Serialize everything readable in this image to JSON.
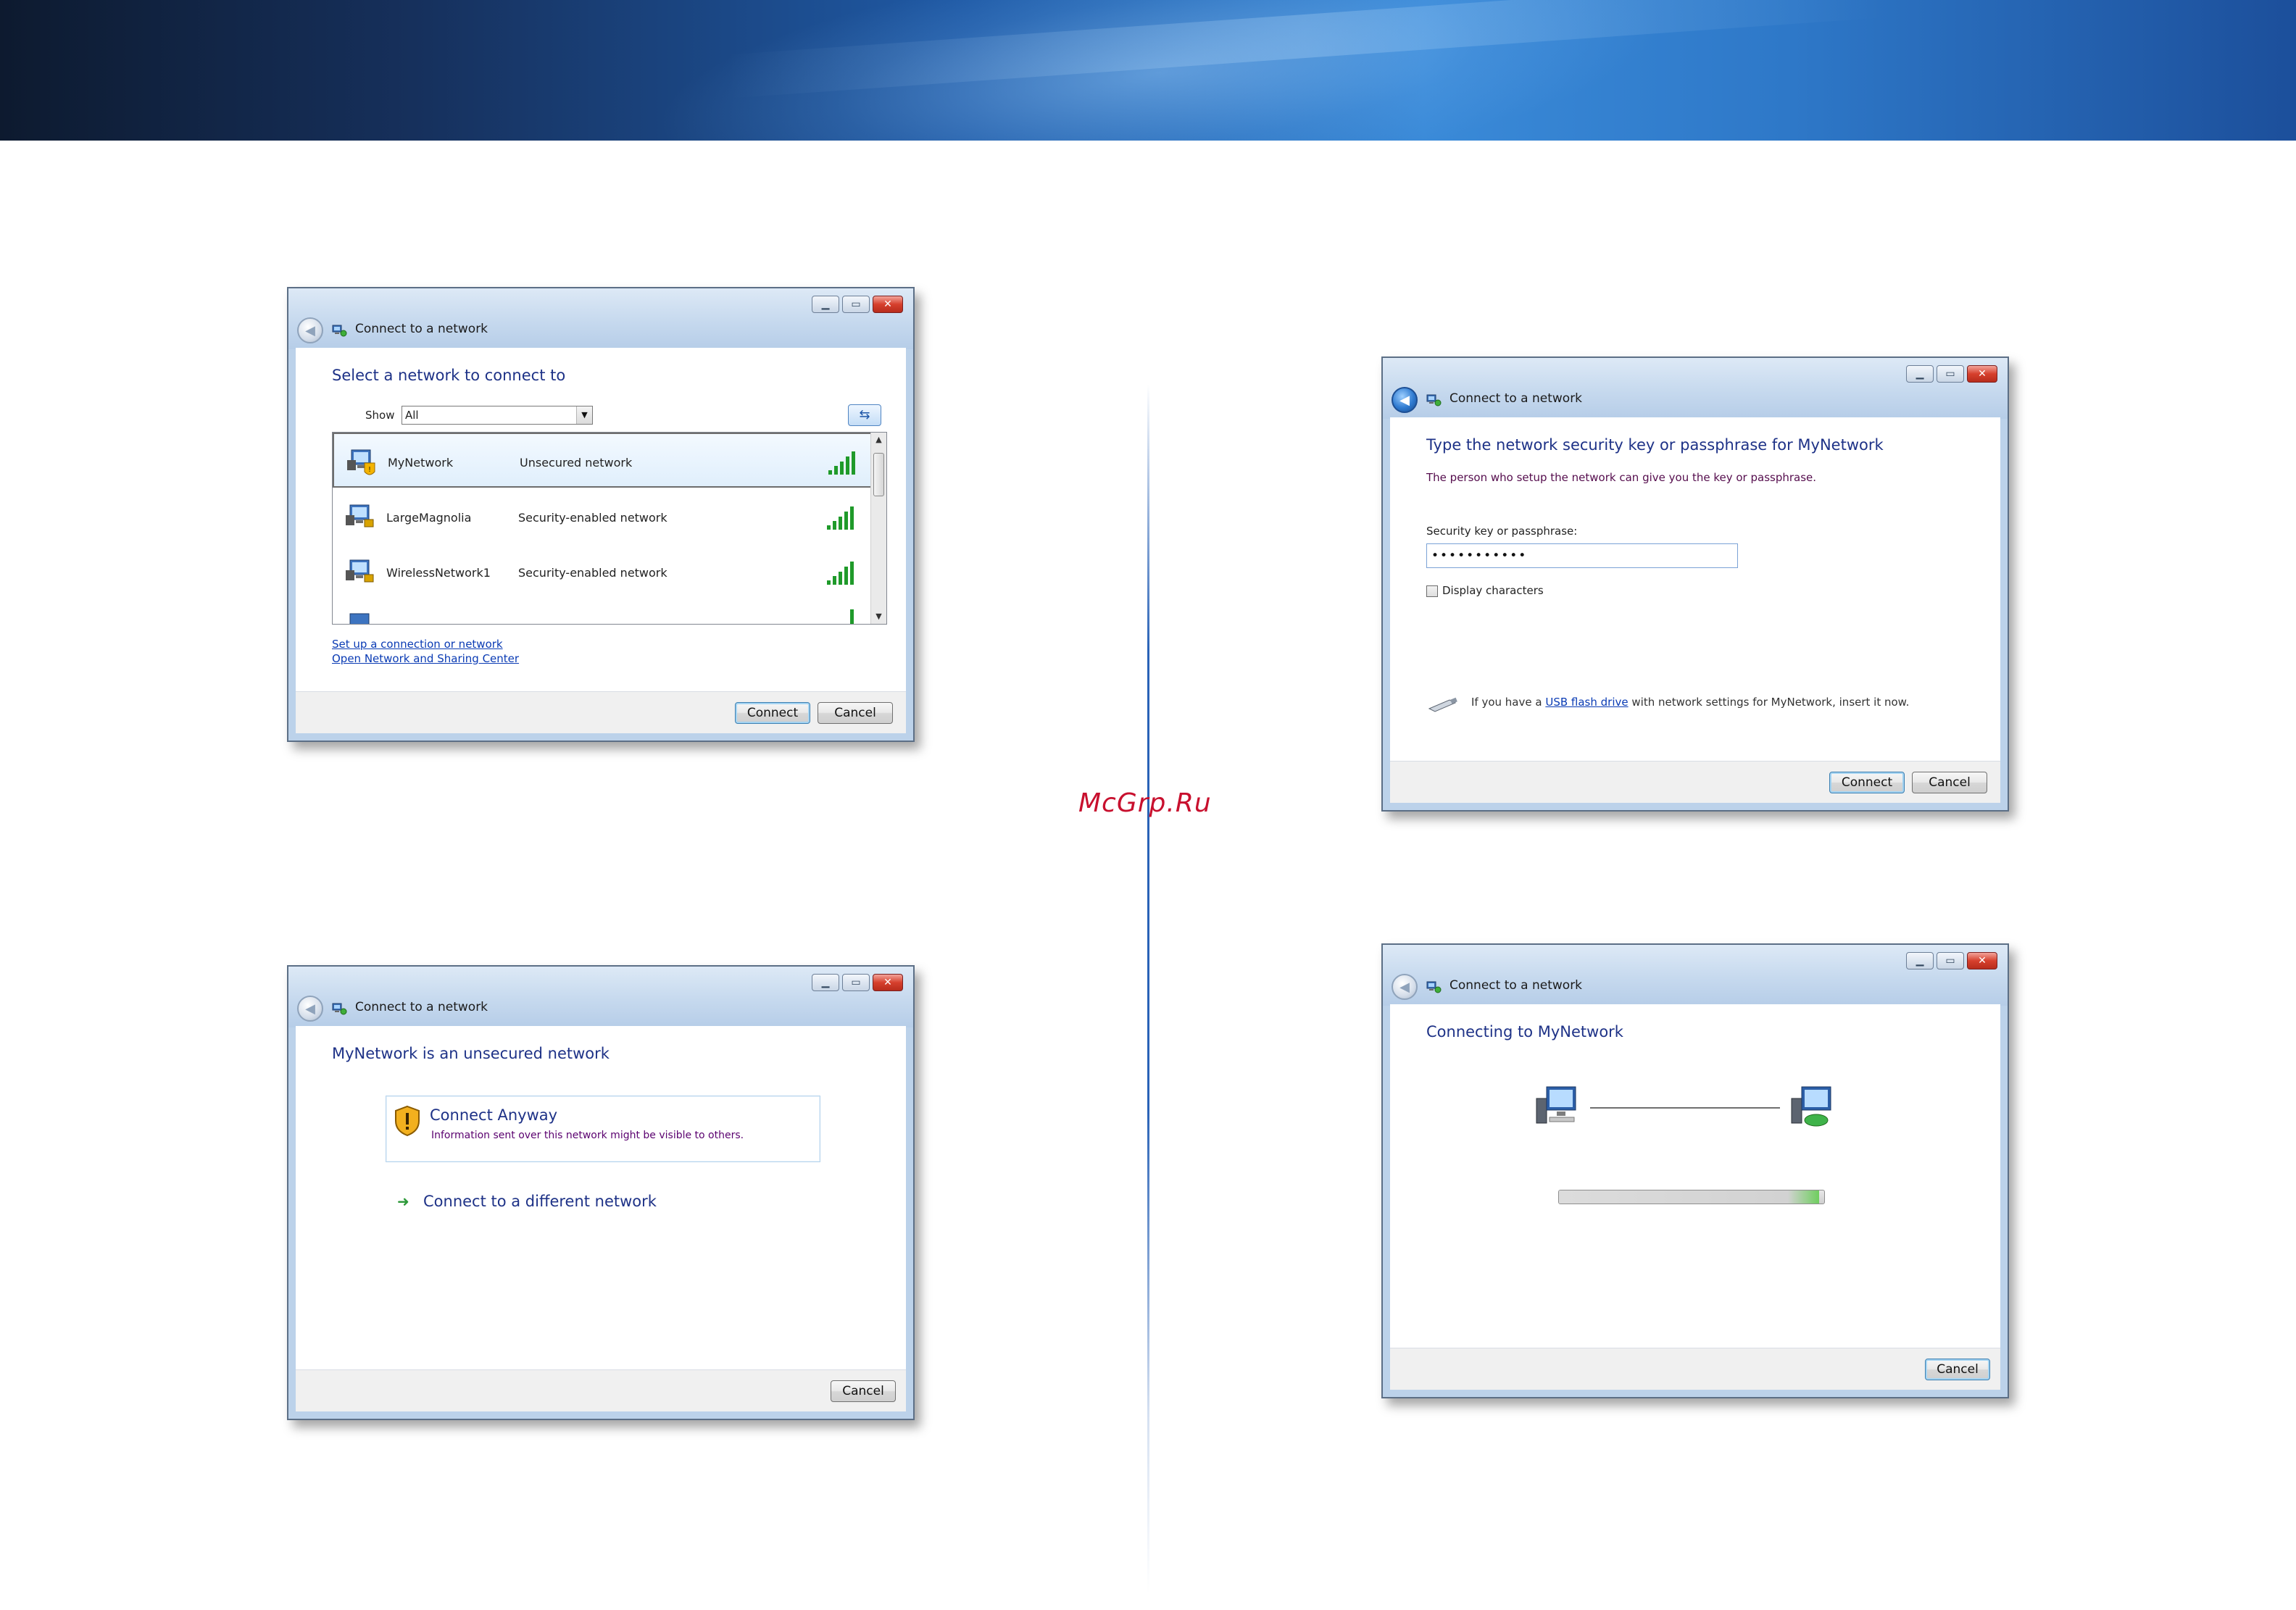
{
  "watermark": "McGrp.Ru",
  "dialog_select": {
    "title": "Connect to a network",
    "heading": "Select a network to connect to",
    "show_label": "Show",
    "show_value": "All",
    "networks": [
      {
        "name": "MyNetwork",
        "status": "Unsecured network",
        "selected": true,
        "security": "unsecured"
      },
      {
        "name": "LargeMagnolia",
        "status": "Security-enabled network",
        "selected": false,
        "security": "secured"
      },
      {
        "name": "WirelessNetwork1",
        "status": "Security-enabled network",
        "selected": false,
        "security": "secured"
      }
    ],
    "links": [
      "Set up a connection or network",
      "Open Network and Sharing Center"
    ],
    "connect_label": "Connect",
    "cancel_label": "Cancel"
  },
  "dialog_unsecured": {
    "title": "Connect to a network",
    "heading": "MyNetwork is an unsecured network",
    "option_title": "Connect Anyway",
    "option_desc": "Information sent over this network might be visible to others.",
    "alt_option": "Connect to a different network",
    "cancel_label": "Cancel"
  },
  "dialog_key": {
    "title": "Connect to a network",
    "heading": "Type the network security key or passphrase for MyNetwork",
    "subtext": "The person who setup the network can give you the key or passphrase.",
    "field_label": "Security key or passphrase:",
    "field_value": "•••••••••••",
    "checkbox_label": "Display characters",
    "checkbox_checked": false,
    "usb_prefix": "If you have a",
    "usb_link": "USB flash drive",
    "usb_suffix": "with network settings for MyNetwork, insert it now.",
    "connect_label": "Connect",
    "cancel_label": "Cancel"
  },
  "dialog_connecting": {
    "title": "Connect to a network",
    "heading": "Connecting to MyNetwork",
    "progress": 0.98,
    "cancel_label": "Cancel"
  },
  "colors": {
    "heading": "#1e3287",
    "link": "#0a3bb4",
    "signal": "#1f9a2a",
    "watermark": "#c8102e"
  }
}
